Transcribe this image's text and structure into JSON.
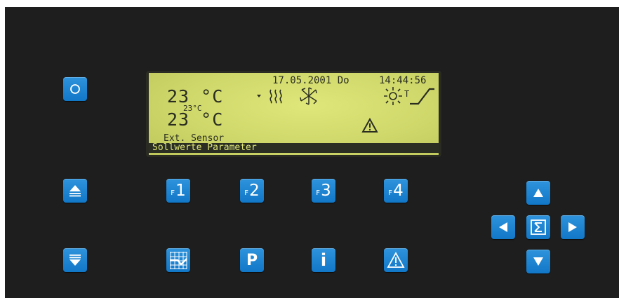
{
  "display": {
    "date": "17.05.2001 Do",
    "time": "14:44:56",
    "temp_main": "23 °C",
    "temp_sub": "23°C",
    "temp_second": "23 °C",
    "sensor_label": "Ext. Sensor",
    "status_line": "Sollwerte Parameter",
    "indicator_icons": [
      "dot-icon",
      "heat-waves-icon",
      "fan-icon",
      "sun-icon",
      "ramp-icon",
      "warning-icon"
    ],
    "ramp_letter": "T"
  },
  "keys": {
    "power": "power-key",
    "f1": {
      "prefix": "F",
      "number": "1"
    },
    "f2": {
      "prefix": "F",
      "number": "2"
    },
    "f3": {
      "prefix": "F",
      "number": "3"
    },
    "f4": {
      "prefix": "F",
      "number": "4"
    },
    "parameter": "P",
    "info": "i"
  },
  "colors": {
    "panel": "#1d1e1d",
    "key_blue": "#1a83d1",
    "lcd_green": "#d3db6c",
    "lcd_ink": "#2a2d20"
  }
}
